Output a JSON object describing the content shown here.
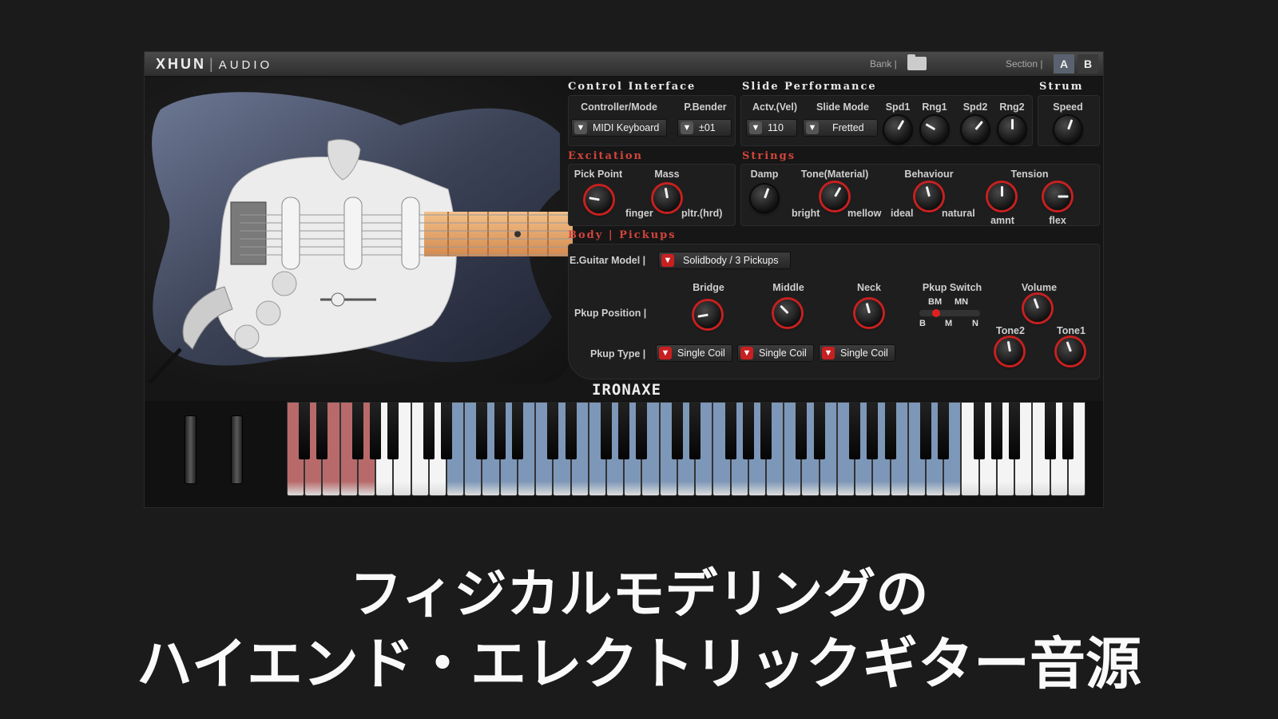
{
  "header": {
    "brand_main": "XHUN",
    "brand_sub": "AUDIO",
    "bank_label": "Bank |",
    "section_label": "Section |",
    "section_a": "A",
    "section_b": "B"
  },
  "control_interface": {
    "title": "Control Interface",
    "controller_label": "Controller/Mode",
    "controller_value": "MIDI Keyboard",
    "pbender_label": "P.Bender",
    "pbender_value": "±01"
  },
  "slide_performance": {
    "title": "Slide Performance",
    "actv_label": "Actv.(Vel)",
    "actv_value": "110",
    "slide_mode_label": "Slide Mode",
    "slide_mode_value": "Fretted",
    "spd1": "Spd1",
    "rng1": "Rng1",
    "spd2": "Spd2",
    "rng2": "Rng2"
  },
  "strum": {
    "title": "Strum",
    "speed_label": "Speed"
  },
  "excitation": {
    "title": "Excitation",
    "pick_point": "Pick Point",
    "mass": "Mass",
    "finger": "finger",
    "pltr": "pltr.(hrd)"
  },
  "strings": {
    "title": "Strings",
    "damp": "Damp",
    "tone": "Tone(Material)",
    "bright": "bright",
    "mellow": "mellow",
    "behaviour": "Behaviour",
    "ideal": "ideal",
    "natural": "natural",
    "tension": "Tension",
    "amnt": "amnt",
    "flex": "flex"
  },
  "body": {
    "title": "Body | Pickups",
    "model_label": "E.Guitar Model |",
    "model_value": "Solidbody / 3 Pickups",
    "pos_label": "Pkup Position |",
    "bridge": "Bridge",
    "middle": "Middle",
    "neck": "Neck",
    "switch_label": "Pkup Switch",
    "bm": "BM",
    "mn": "MN",
    "b": "B",
    "m": "M",
    "n": "N",
    "volume": "Volume",
    "tone2": "Tone2",
    "tone1": "Tone1",
    "type_label": "Pkup Type |",
    "type_values": [
      "Single Coil",
      "Single Coil",
      "Single Coil"
    ]
  },
  "product_name": "IRONAXE",
  "caption": {
    "line1": "フィジカルモデリングの",
    "line2": "ハイエンド・エレクトリックギター音源"
  },
  "colors": {
    "accent_red": "#c82020",
    "key_red": "#b86a6a",
    "key_blue": "#7d97b8"
  }
}
